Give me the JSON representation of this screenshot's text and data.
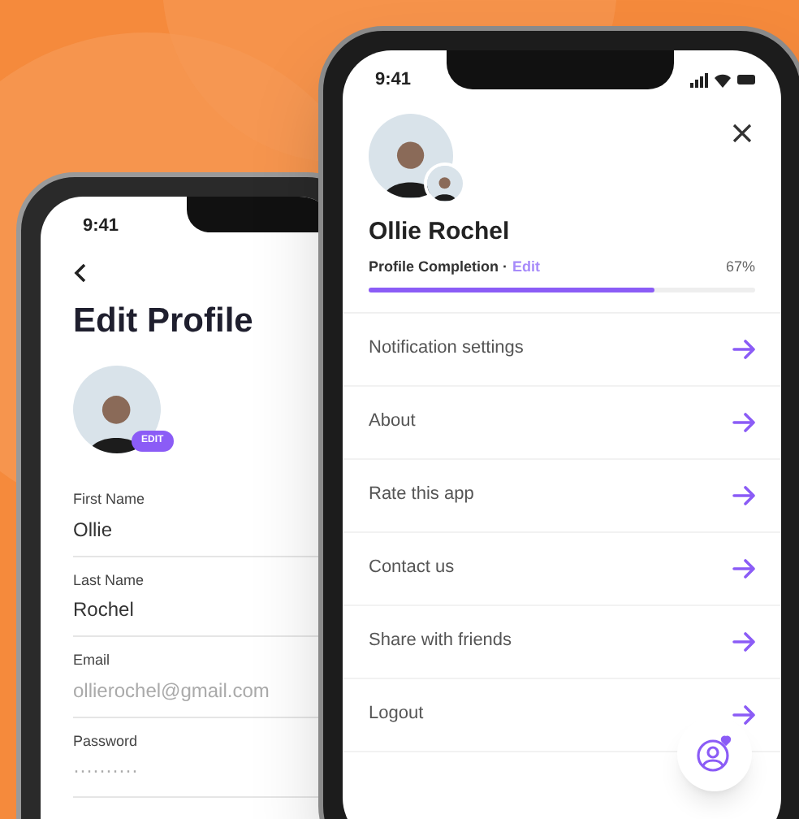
{
  "left_phone": {
    "status_time": "9:41",
    "title": "Edit Profile",
    "avatar_badge": "EDIT",
    "fields": [
      {
        "label": "First Name",
        "value": "Ollie",
        "muted": false
      },
      {
        "label": "Last Name",
        "value": "Rochel",
        "muted": false
      },
      {
        "label": "Email",
        "value": "ollierochel@gmail.com",
        "muted": true
      },
      {
        "label": "Password",
        "value": "··········",
        "muted": true
      }
    ]
  },
  "right_phone": {
    "status_time": "9:41",
    "name": "Ollie Rochel",
    "completion_label": "Profile Completion ·",
    "completion_link": "Edit",
    "completion_percent": "67%",
    "level": 0.74,
    "menu": [
      {
        "label": "Notification settings"
      },
      {
        "label": "About"
      },
      {
        "label": "Rate this app"
      },
      {
        "label": "Contact us"
      },
      {
        "label": "Share with friends"
      },
      {
        "label": "Logout"
      }
    ]
  }
}
